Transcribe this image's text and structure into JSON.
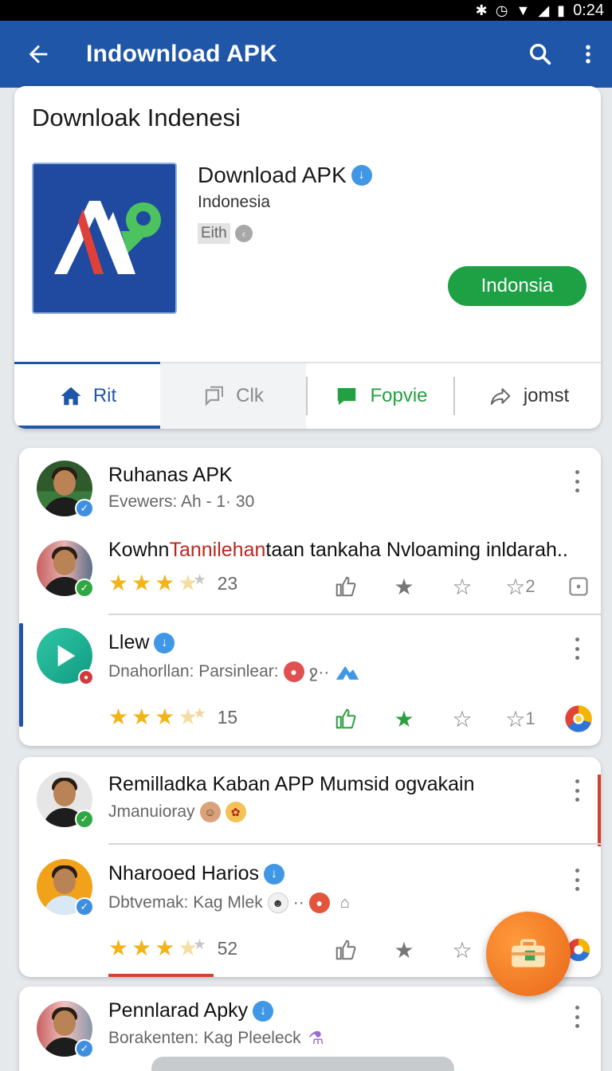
{
  "status_bar": {
    "time": "0:24",
    "icons": [
      "bluetooth-icon",
      "alarm-icon",
      "wifi-icon",
      "signal-icon",
      "battery-icon"
    ]
  },
  "app_bar": {
    "title": "Indownload APK",
    "icons": [
      "back-arrow-icon",
      "search-icon",
      "more-vert-icon"
    ]
  },
  "header": {
    "section_title": "Downloak Indenesi",
    "app": {
      "name": "Download APK",
      "region": "Indonesia",
      "tag": "Eith"
    },
    "install_label": "Indonsia",
    "tabs": [
      {
        "label": "Rit",
        "icon": "home-icon"
      },
      {
        "label": "Clk",
        "icon": "chat-outline-icon"
      },
      {
        "label": "Fopvie",
        "icon": "chat-bubble-icon"
      },
      {
        "label": "jomst",
        "icon": "share-icon"
      }
    ]
  },
  "feed": [
    {
      "title": "Ruhanas APK",
      "subtitle": "Evewers: Ah - 1· 30"
    },
    {
      "title_prefix": "Kowhn ",
      "title_highlight": "Tannilehan",
      "title_suffix": "taan tankaha Nvloaming inldarah..",
      "rating_count": "23",
      "share_count": "2"
    },
    {
      "title": "Llew",
      "subtitle": "Dnahorllan: Parsinlear:",
      "emoji_text": "ջ··",
      "rating_count": "15",
      "share_count": "1"
    },
    {
      "title": "Remilladka Kaban APP Mumsid ogvakain",
      "subtitle": "Jmanuioray"
    },
    {
      "title": "Nharooed Harios",
      "subtitle": "Dbtvemak: Kag Mlek",
      "emoji_text": "··",
      "rating_count": "52"
    },
    {
      "title": "Pennlarad Apky",
      "subtitle": "Borakenten: Kag Pleeleck"
    }
  ],
  "colors": {
    "app_bar": "#1f56a8",
    "install": "#1ea044",
    "fab": "#e8661a",
    "star": "#f2b416"
  }
}
